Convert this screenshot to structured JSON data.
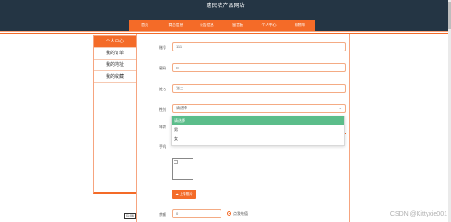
{
  "site_title": "惠民农产品网站",
  "nav": [
    "首页",
    "商品信息",
    "公告信息",
    "留言板",
    "个人中心",
    "购物车"
  ],
  "sidebar": [
    "个人中心",
    "我的订单",
    "我的地址",
    "我的收藏"
  ],
  "form": {
    "account_label": "账号",
    "account_value": "111",
    "password_label": "密码",
    "password_value": "••",
    "name_label": "姓名",
    "name_value": "张三",
    "gender_label": "性别",
    "gender_placeholder": "请选择",
    "age_label": "年龄",
    "phone_label": "手机",
    "upload_label": "上传照片",
    "balance_label": "余额",
    "balance_value": "0",
    "recharge_label": "点我充值"
  },
  "dropdown": [
    "请选择",
    "男",
    "女"
  ],
  "float_tag": "01:06",
  "watermark": "CSDN @Kittyxie001",
  "colors": {
    "accent": "#f46b28",
    "header": "#243544",
    "highlight": "#5bbd8a"
  },
  "icons": [
    "chevron-down-icon",
    "upload-icon",
    "broken-image-icon",
    "radio-icon"
  ]
}
